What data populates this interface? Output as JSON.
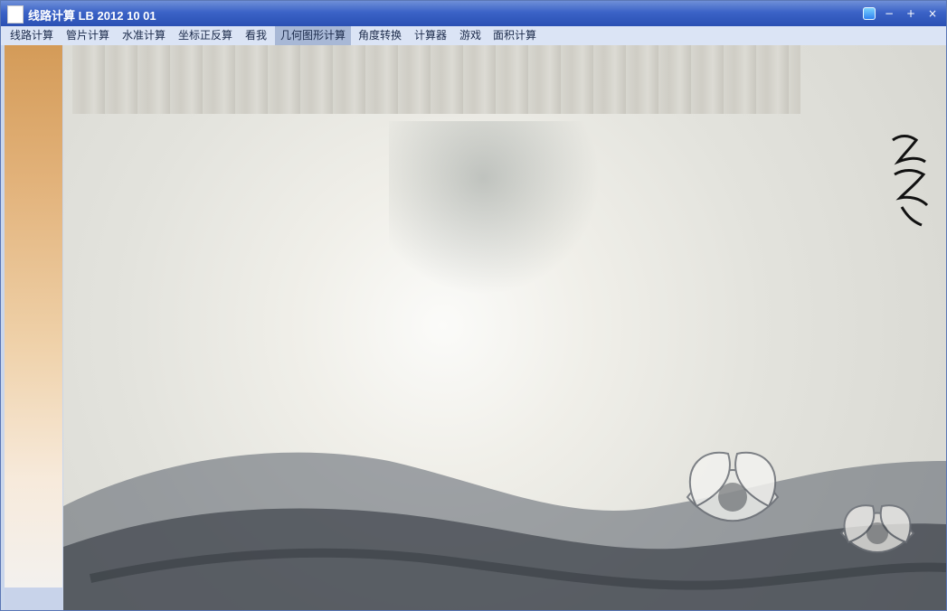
{
  "window": {
    "title": "线路计算 LB 2012 10 01"
  },
  "menu": {
    "items": [
      {
        "label": "线路计算"
      },
      {
        "label": "管片计算"
      },
      {
        "label": "水准计算"
      },
      {
        "label": "坐标正反算"
      },
      {
        "label": "看我"
      },
      {
        "label": "几何图形计算"
      },
      {
        "label": "角度转换"
      },
      {
        "label": "计算器"
      },
      {
        "label": "游戏"
      },
      {
        "label": "面积计算"
      }
    ],
    "active_index": 5
  },
  "icons": {
    "app_icon": "app-icon",
    "pin_icon": "pin-icon",
    "minimize_icon": "minimize-icon",
    "maximize_icon": "maximize-icon",
    "close_icon": "close-icon"
  }
}
